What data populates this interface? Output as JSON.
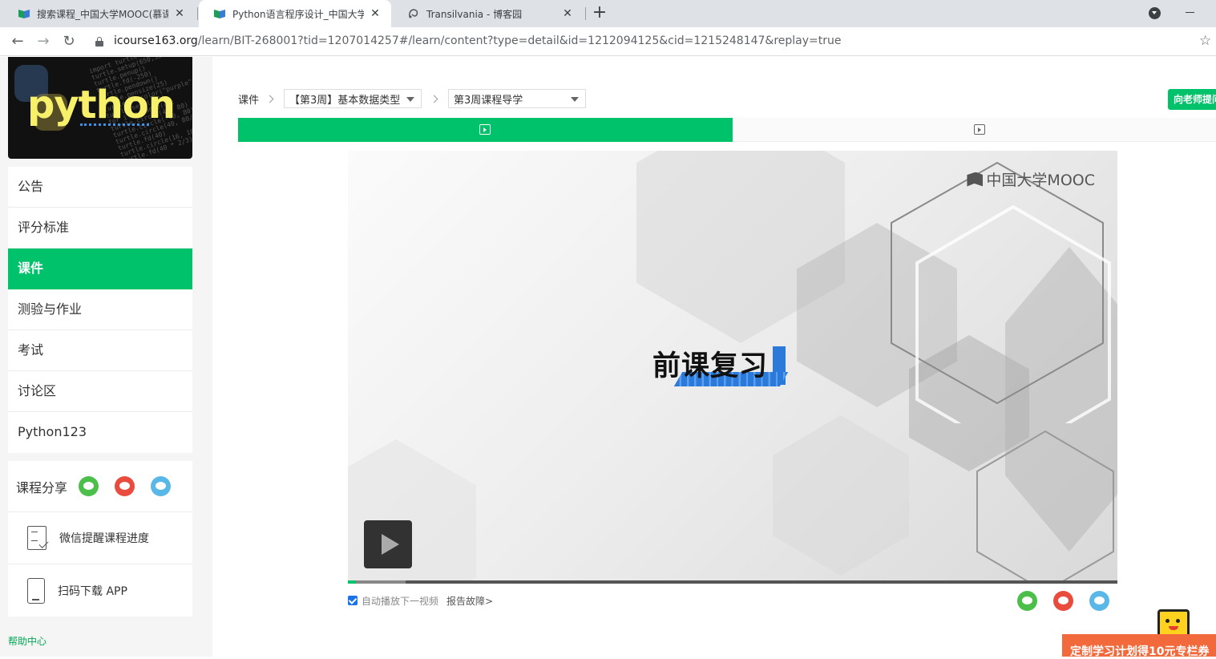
{
  "browser": {
    "tabs": [
      {
        "title": "搜索课程_中国大学MOOC(慕课)",
        "favicon": "mooc-book-icon",
        "active": false
      },
      {
        "title": "Python语言程序设计_中国大学MOOC",
        "favicon": "mooc-book-icon",
        "active": true
      },
      {
        "title": "Transilvania - 博客园",
        "favicon": "cnblogs-icon",
        "active": false
      }
    ],
    "url_host": "icourse163.org",
    "url_path": "/learn/BIT-268001?tid=1207014257#/learn/content?type=detail&id=1212094125&cid=1215248147&replay=true"
  },
  "course": {
    "image_word": "python",
    "code_lines": [
      "import turtle",
      "turtle.setup(650,350)",
      "turtle.penup()",
      "turtle.fd(-250)",
      "turtle.pendown()",
      "turtle.pensize(25)",
      "turtle.pencolor(\"purple\")",
      "turtle.seth(-40)",
      "for i in range(4):",
      "turtle.circle(40, 80)",
      "turtle.circle(-40, 80)",
      "turtle.circle(40, 80/2)",
      "turtle.fd(40)",
      "turtle.circle(16, 180)",
      "turtle.fd(40 * 2/3)"
    ]
  },
  "sidebar": {
    "menu": [
      {
        "label": "公告",
        "active": false
      },
      {
        "label": "评分标准",
        "active": false
      },
      {
        "label": "课件",
        "active": true
      },
      {
        "label": "测验与作业",
        "active": false
      },
      {
        "label": "考试",
        "active": false
      },
      {
        "label": "讨论区",
        "active": false
      },
      {
        "label": "Python123",
        "active": false
      }
    ],
    "share_label": "课程分享",
    "wechat_reminder": "微信提醒课程进度",
    "download_app": "扫码下载 APP",
    "help": "帮助中心"
  },
  "main": {
    "breadcrumb_root": "课件",
    "week_select": "【第3周】基本数据类型",
    "lesson_select": "第3周课程导学",
    "ask_teacher": "向老师提问",
    "video_title": "前课复习",
    "watermark": "中国大学MOOC",
    "progress_played": 0.01,
    "progress_buffered": 0.075,
    "autoplay_label": "自动播放下一视频",
    "autoplay_checked": true,
    "report_label": "报告故障>"
  },
  "promo": {
    "text": "定制学习计划得10元专栏券"
  },
  "colors": {
    "accent": "#00c26a",
    "wechat": "#4cbf4b",
    "weibo": "#e94b3c",
    "qq": "#5ab8e8",
    "promo": "#f26a3c"
  }
}
